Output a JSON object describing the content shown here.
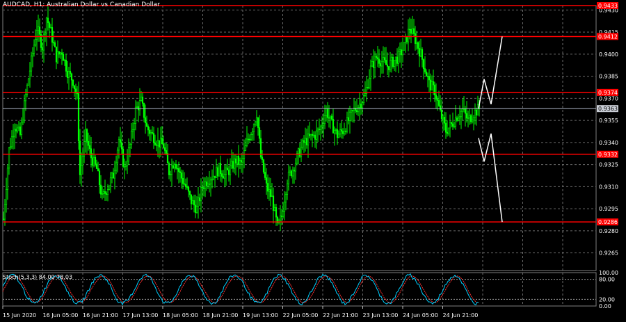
{
  "chart_title": "AUDCAD, H1:  Australian Dollar vs Canadian Dollar",
  "indicator_label": "Stoch(5,3,3) 84.00 78.03",
  "colors": {
    "background": "#000000",
    "grid": "#6a6a6a",
    "bull_candle": "#00ff00",
    "bear_candle": "#00ff00",
    "level_line": "#ff0000",
    "current_price_line": "#b0b8c8",
    "projection": "#ffffff",
    "stoch_main": "#00d0ff",
    "stoch_signal": "#ff3030",
    "axis_text": "#ffffff"
  },
  "chart_data": {
    "type": "candlestick",
    "symbol": "AUDCAD",
    "timeframe": "H1",
    "y_ticks": [
      "0.9430",
      "0.9415",
      "0.9400",
      "0.9385",
      "0.9370",
      "0.9355",
      "0.9340",
      "0.9325",
      "0.9310",
      "0.9295",
      "0.9280",
      "0.9265"
    ],
    "x_ticks": [
      "15 Jun 2020",
      "16 Jun 05:00",
      "16 Jun 21:00",
      "17 Jun 13:00",
      "18 Jun 05:00",
      "18 Jun 21:00",
      "19 Jun 13:00",
      "22 Jun 05:00",
      "22 Jun 21:00",
      "23 Jun 13:00",
      "24 Jun 05:00",
      "24 Jun 21:00"
    ],
    "ylim": [
      0.9253,
      0.9433
    ],
    "resistance_support_levels": [
      {
        "label": "0.9433",
        "value": 0.9433
      },
      {
        "label": "0.9412",
        "value": 0.9412
      },
      {
        "label": "0.9374",
        "value": 0.9374
      },
      {
        "label": "0.9332",
        "value": 0.9332
      },
      {
        "label": "0.9286",
        "value": 0.9286
      }
    ],
    "current_price": {
      "label": "0.9363",
      "value": 0.9363
    },
    "price_path": [
      [
        0,
        0.9288
      ],
      [
        8,
        0.9335
      ],
      [
        16,
        0.9352
      ],
      [
        24,
        0.9345
      ],
      [
        32,
        0.9372
      ],
      [
        40,
        0.9395
      ],
      [
        48,
        0.9418
      ],
      [
        56,
        0.9405
      ],
      [
        62,
        0.9425
      ],
      [
        68,
        0.9415
      ],
      [
        76,
        0.9398
      ],
      [
        84,
        0.9402
      ],
      [
        92,
        0.9388
      ],
      [
        100,
        0.9382
      ],
      [
        106,
        0.937
      ],
      [
        110,
        0.9318
      ],
      [
        118,
        0.9345
      ],
      [
        126,
        0.933
      ],
      [
        134,
        0.9322
      ],
      [
        142,
        0.9302
      ],
      [
        150,
        0.931
      ],
      [
        158,
        0.9318
      ],
      [
        166,
        0.9342
      ],
      [
        174,
        0.9322
      ],
      [
        182,
        0.9338
      ],
      [
        190,
        0.9362
      ],
      [
        198,
        0.9368
      ],
      [
        206,
        0.935
      ],
      [
        214,
        0.9345
      ],
      [
        222,
        0.934
      ],
      [
        230,
        0.9338
      ],
      [
        238,
        0.932
      ],
      [
        246,
        0.9328
      ],
      [
        254,
        0.9318
      ],
      [
        262,
        0.931
      ],
      [
        270,
        0.93
      ],
      [
        278,
        0.9295
      ],
      [
        286,
        0.931
      ],
      [
        294,
        0.9315
      ],
      [
        302,
        0.9318
      ],
      [
        310,
        0.9322
      ],
      [
        318,
        0.9318
      ],
      [
        326,
        0.9322
      ],
      [
        334,
        0.9328
      ],
      [
        342,
        0.9325
      ],
      [
        350,
        0.934
      ],
      [
        358,
        0.935
      ],
      [
        364,
        0.936
      ],
      [
        370,
        0.933
      ],
      [
        378,
        0.931
      ],
      [
        386,
        0.9302
      ],
      [
        394,
        0.9282
      ],
      [
        400,
        0.929
      ],
      [
        408,
        0.9315
      ],
      [
        416,
        0.9322
      ],
      [
        424,
        0.9332
      ],
      [
        432,
        0.934
      ],
      [
        440,
        0.9343
      ],
      [
        448,
        0.9345
      ],
      [
        456,
        0.935
      ],
      [
        464,
        0.9362
      ],
      [
        472,
        0.9352
      ],
      [
        480,
        0.9345
      ],
      [
        488,
        0.9348
      ],
      [
        496,
        0.9355
      ],
      [
        504,
        0.9362
      ],
      [
        512,
        0.9366
      ],
      [
        520,
        0.9372
      ],
      [
        528,
        0.939
      ],
      [
        536,
        0.9398
      ],
      [
        544,
        0.9395
      ],
      [
        552,
        0.9392
      ],
      [
        560,
        0.9395
      ],
      [
        568,
        0.9398
      ],
      [
        576,
        0.9405
      ],
      [
        584,
        0.9418
      ],
      [
        592,
        0.941
      ],
      [
        600,
        0.94
      ],
      [
        606,
        0.939
      ],
      [
        612,
        0.938
      ],
      [
        620,
        0.9375
      ],
      [
        628,
        0.936
      ],
      [
        636,
        0.9348
      ],
      [
        644,
        0.9352
      ],
      [
        652,
        0.9358
      ],
      [
        660,
        0.9362
      ],
      [
        668,
        0.9355
      ],
      [
        676,
        0.936
      ],
      [
        684,
        0.9363
      ]
    ],
    "projection_path": [
      [
        684,
        0.9363
      ],
      [
        692,
        0.9383
      ],
      [
        702,
        0.9366
      ],
      [
        718,
        0.9412
      ],
      [
        684,
        0.9343
      ],
      [
        692,
        0.9327
      ],
      [
        702,
        0.9346
      ],
      [
        718,
        0.9286
      ]
    ],
    "stochastic": {
      "levels": [
        "100.00",
        "80.00",
        "20.00",
        "0.00"
      ],
      "main": 84.0,
      "signal": 78.03
    }
  }
}
